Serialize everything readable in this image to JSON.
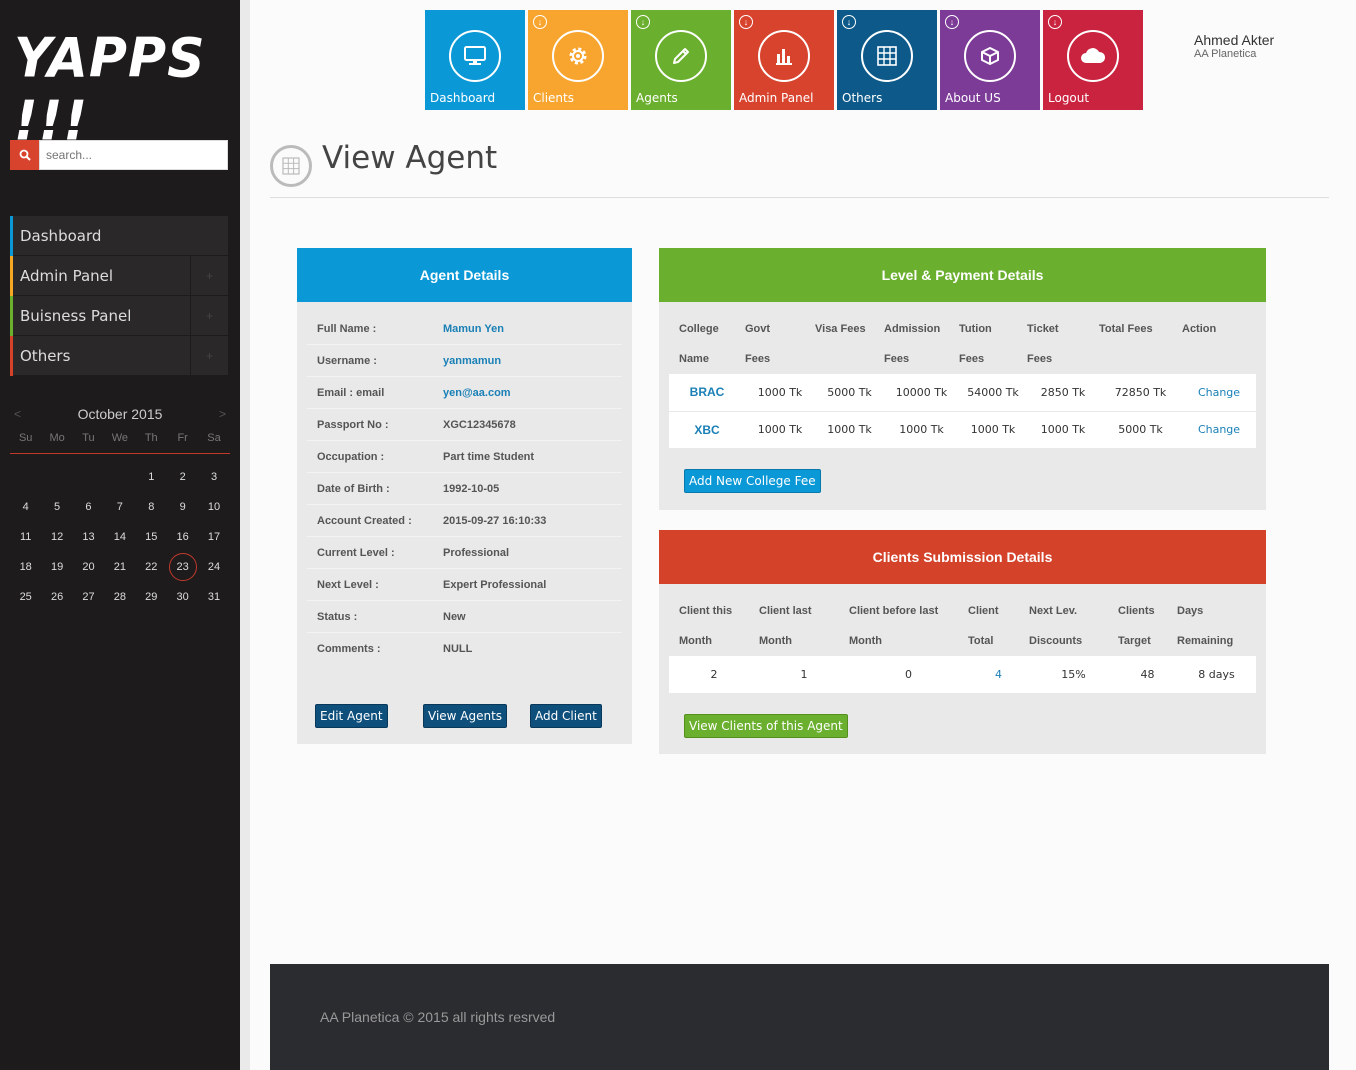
{
  "app": {
    "logo": "YAPPS !!!"
  },
  "search": {
    "placeholder": "search..."
  },
  "sidebar": {
    "items": [
      {
        "label": "Dashboard",
        "color": "#0a98d6"
      },
      {
        "label": "Admin Panel",
        "color": "#f5a623"
      },
      {
        "label": "Buisness Panel",
        "color": "#6aaf2d"
      },
      {
        "label": "Others",
        "color": "#d4422a"
      }
    ]
  },
  "calendar": {
    "month": "October 2015",
    "days_of_week": [
      "Su",
      "Mo",
      "Tu",
      "We",
      "Th",
      "Fr",
      "Sa"
    ],
    "weeks": [
      [
        "",
        "",
        "",
        "",
        "1",
        "2",
        "3"
      ],
      [
        "4",
        "5",
        "6",
        "7",
        "8",
        "9",
        "10"
      ],
      [
        "11",
        "12",
        "13",
        "14",
        "15",
        "16",
        "17"
      ],
      [
        "18",
        "19",
        "20",
        "21",
        "22",
        "23",
        "24"
      ],
      [
        "25",
        "26",
        "27",
        "28",
        "29",
        "30",
        "31"
      ]
    ],
    "today": "23"
  },
  "tiles": [
    {
      "label": "Dashboard",
      "color": "#0a98d6",
      "icon": "monitor-icon"
    },
    {
      "label": "Clients",
      "color": "#f8a52f",
      "icon": "gear-icon"
    },
    {
      "label": "Agents",
      "color": "#6aaf2d",
      "icon": "pencil-icon"
    },
    {
      "label": "Admin Panel",
      "color": "#d8432e",
      "icon": "bar-chart-icon"
    },
    {
      "label": "Others",
      "color": "#0d5a8a",
      "icon": "grid-icon"
    },
    {
      "label": "About US",
      "color": "#7d3b98",
      "icon": "box-icon"
    },
    {
      "label": "Logout",
      "color": "#c9233f",
      "icon": "cloud-icon"
    }
  ],
  "user": {
    "name": "Ahmed Akter",
    "org": "AA Planetica"
  },
  "page": {
    "title": "View Agent"
  },
  "agent": {
    "heading": "Agent Details",
    "rows": [
      {
        "key": "Full Name :",
        "value": "Mamun Yen",
        "link": true
      },
      {
        "key": "Username :",
        "value": "yanmamun",
        "link": true
      },
      {
        "key": "Email : email",
        "value": "yen@aa.com",
        "link": true
      },
      {
        "key": "Passport No :",
        "value": "XGC12345678",
        "link": false
      },
      {
        "key": "Occupation :",
        "value": "Part time Student",
        "link": false
      },
      {
        "key": "Date of Birth :",
        "value": "1992-10-05",
        "link": false
      },
      {
        "key": "Account Created :",
        "value": "2015-09-27 16:10:33",
        "link": false
      },
      {
        "key": "Current Level :",
        "value": "Professional",
        "link": false
      },
      {
        "key": "Next Level :",
        "value": "Expert Professional",
        "link": false
      },
      {
        "key": "Status :",
        "value": "New",
        "link": false
      },
      {
        "key": "Comments :",
        "value": "NULL",
        "link": false
      }
    ],
    "buttons": {
      "edit": "Edit Agent",
      "view": "View Agents",
      "add": "Add Client"
    }
  },
  "payment": {
    "heading": "Level & Payment Details",
    "headers": [
      [
        "College",
        "Name"
      ],
      [
        "Govt",
        "Fees"
      ],
      [
        "Visa Fees",
        ""
      ],
      [
        "Admission",
        "Fees"
      ],
      [
        "Tution",
        "Fees"
      ],
      [
        "Ticket",
        "Fees"
      ],
      [
        "Total Fees",
        ""
      ],
      [
        "Action",
        ""
      ]
    ],
    "rows": [
      [
        "BRAC",
        "1000 Tk",
        "5000 Tk",
        "10000 Tk",
        "54000 Tk",
        "2850 Tk",
        "72850 Tk",
        "Change"
      ],
      [
        "XBC",
        "1000 Tk",
        "1000 Tk",
        "1000 Tk",
        "1000 Tk",
        "1000 Tk",
        "5000 Tk",
        "Change"
      ]
    ],
    "add_button": "Add New College Fee"
  },
  "clients": {
    "heading": "Clients Submission Details",
    "headers": [
      [
        "Client this",
        "Month"
      ],
      [
        "Client last",
        "Month"
      ],
      [
        "Client before last",
        "Month"
      ],
      [
        "Client",
        "Total"
      ],
      [
        "Next Lev.",
        "Discounts"
      ],
      [
        "Clients",
        "Target"
      ],
      [
        "Days",
        "Remaining"
      ]
    ],
    "row": [
      "2",
      "1",
      "0",
      "4",
      "15%",
      "48",
      "8 days"
    ],
    "view_button": "View Clients of this Agent"
  },
  "footer": {
    "copyright": "AA Planetica © 2015 all rights resrved"
  }
}
